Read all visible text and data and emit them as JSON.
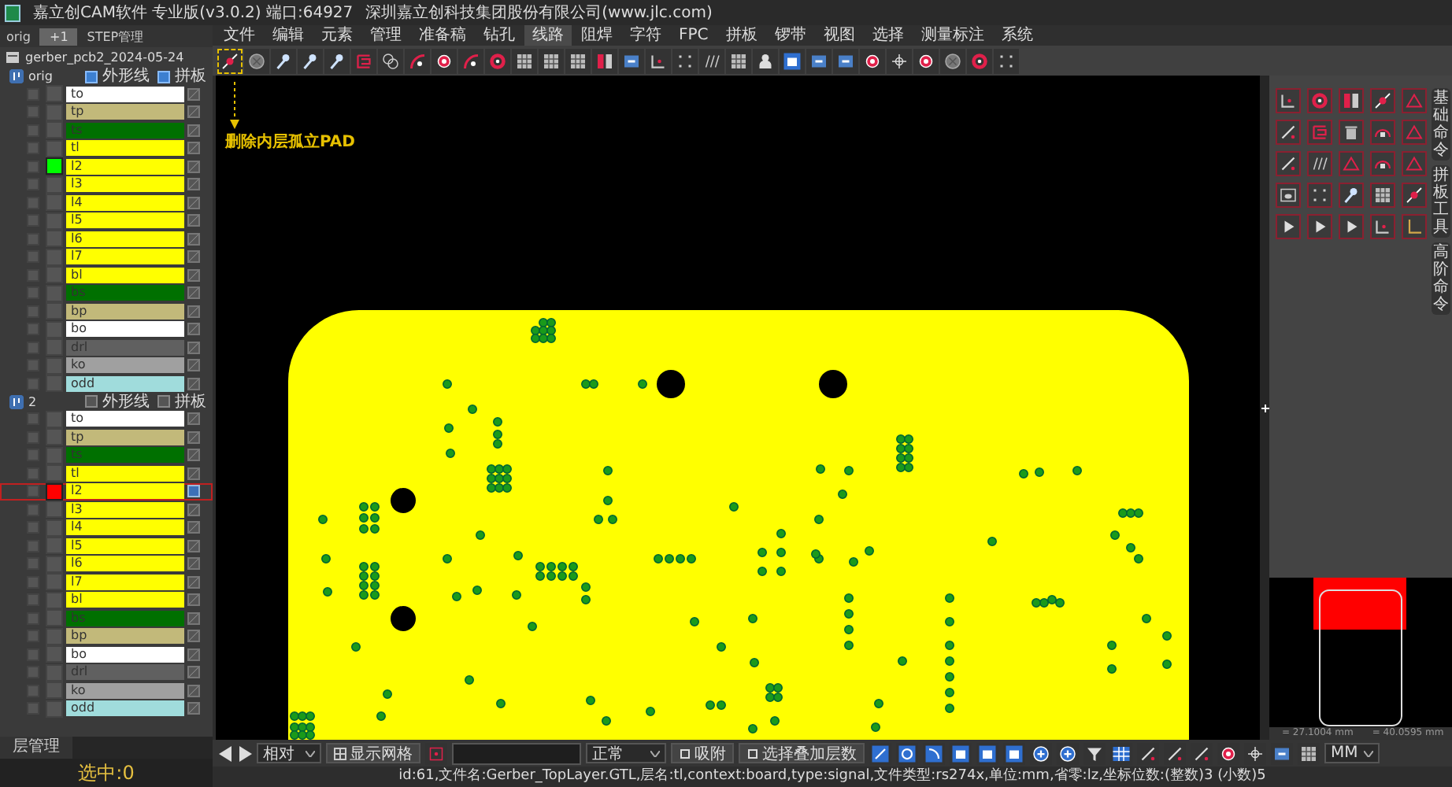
{
  "window": {
    "title": "嘉立创CAM软件 专业版(v3.0.2) 端口:64927",
    "company": "深圳嘉立创科技集团股份有限公司(www.jlc.com)"
  },
  "menu": [
    {
      "label": "文件",
      "selected": false
    },
    {
      "label": "编辑",
      "selected": false
    },
    {
      "label": "元素",
      "selected": false
    },
    {
      "label": "管理",
      "selected": false
    },
    {
      "label": "准备稿",
      "selected": false
    },
    {
      "label": "钻孔",
      "selected": false
    },
    {
      "label": "线路",
      "selected": true
    },
    {
      "label": "阻焊",
      "selected": false
    },
    {
      "label": "字符",
      "selected": false
    },
    {
      "label": "FPC",
      "selected": false
    },
    {
      "label": "拼板",
      "selected": false
    },
    {
      "label": "锣带",
      "selected": false
    },
    {
      "label": "视图",
      "selected": false
    },
    {
      "label": "选择",
      "selected": false
    },
    {
      "label": "测量标注",
      "selected": false
    },
    {
      "label": "系统",
      "selected": false
    }
  ],
  "toolbar": {
    "tools": [
      {
        "selected": true
      },
      {
        "selected": false
      },
      {
        "selected": false
      },
      {
        "selected": false
      },
      {
        "selected": false
      },
      {
        "selected": false
      },
      {
        "selected": false
      },
      {
        "selected": false
      },
      {
        "selected": false
      },
      {
        "selected": false
      },
      {
        "selected": false
      },
      {
        "selected": false
      },
      {
        "selected": false
      },
      {
        "selected": false
      },
      {
        "selected": false
      },
      {
        "selected": false
      },
      {
        "selected": false
      },
      {
        "selected": false
      },
      {
        "selected": false
      },
      {
        "selected": false
      },
      {
        "selected": false
      },
      {
        "selected": false
      },
      {
        "selected": false
      },
      {
        "selected": false
      },
      {
        "selected": false
      },
      {
        "selected": false
      },
      {
        "selected": false
      },
      {
        "selected": false
      },
      {
        "selected": false
      },
      {
        "selected": false
      }
    ]
  },
  "tooltip": {
    "text": "删除内层孤立PAD"
  },
  "left_panel": {
    "step_tab": "orig",
    "add_button": "+1",
    "step_manager": "STEP管理",
    "job": "gerber_pcb2_2024-05-24",
    "steps": [
      {
        "name": "orig",
        "outline_label": "外形线",
        "outline_checked": true,
        "panel_label": "拼板",
        "panel_checked": true,
        "layers": [
          {
            "name": "to",
            "color": "#ffffff",
            "checked": false,
            "selected": false,
            "active": false
          },
          {
            "name": "tp",
            "color": "#c2b97a",
            "checked": false,
            "selected": false,
            "active": false
          },
          {
            "name": "ts",
            "color": "#007000",
            "checked": false,
            "selected": false,
            "active": false
          },
          {
            "name": "tl",
            "color": "#ffff00",
            "checked": false,
            "selected": false,
            "active": false
          },
          {
            "name": "l2",
            "color": "#ffff00",
            "checked": false,
            "selected": false,
            "active": true,
            "marker": {
              "color": "#00ff00"
            }
          },
          {
            "name": "l3",
            "color": "#ffff00",
            "checked": false,
            "selected": false,
            "active": false
          },
          {
            "name": "l4",
            "color": "#ffff00",
            "checked": false,
            "selected": false,
            "active": false
          },
          {
            "name": "l5",
            "color": "#ffff00",
            "checked": false,
            "selected": false,
            "active": false
          },
          {
            "name": "l6",
            "color": "#ffff00",
            "checked": false,
            "selected": false,
            "active": false
          },
          {
            "name": "l7",
            "color": "#ffff00",
            "checked": false,
            "selected": false,
            "active": false
          },
          {
            "name": "bl",
            "color": "#ffff00",
            "checked": false,
            "selected": false,
            "active": false
          },
          {
            "name": "bs",
            "color": "#007000",
            "checked": false,
            "selected": false,
            "active": false
          },
          {
            "name": "bp",
            "color": "#c2b97a",
            "checked": false,
            "selected": false,
            "active": false
          },
          {
            "name": "bo",
            "color": "#ffffff",
            "checked": false,
            "selected": false,
            "active": false
          },
          {
            "name": "drl",
            "color": "#606060",
            "checked": false,
            "selected": false,
            "active": false
          },
          {
            "name": "ko",
            "color": "#a0a0a0",
            "checked": false,
            "selected": false,
            "active": false
          },
          {
            "name": "odd",
            "color": "#a0dcdc",
            "checked": false,
            "selected": false,
            "active": false
          }
        ]
      },
      {
        "name": "2",
        "outline_label": "外形线",
        "outline_checked": false,
        "panel_label": "拼板",
        "panel_checked": false,
        "layers": [
          {
            "name": "to",
            "color": "#ffffff",
            "checked": false,
            "selected": false,
            "active": false
          },
          {
            "name": "tp",
            "color": "#c2b97a",
            "checked": false,
            "selected": false,
            "active": false
          },
          {
            "name": "ts",
            "color": "#007000",
            "checked": false,
            "selected": false,
            "active": false
          },
          {
            "name": "tl",
            "color": "#ffff00",
            "checked": false,
            "selected": false,
            "active": false
          },
          {
            "name": "l2",
            "color": "#ffff00",
            "checked": false,
            "selected": true,
            "active": true,
            "marker": {
              "color": "#ff0000"
            }
          },
          {
            "name": "l3",
            "color": "#ffff00",
            "checked": false,
            "selected": false,
            "active": false
          },
          {
            "name": "l4",
            "color": "#ffff00",
            "checked": false,
            "selected": false,
            "active": false
          },
          {
            "name": "l5",
            "color": "#ffff00",
            "checked": false,
            "selected": false,
            "active": false
          },
          {
            "name": "l6",
            "color": "#ffff00",
            "checked": false,
            "selected": false,
            "active": false
          },
          {
            "name": "l7",
            "color": "#ffff00",
            "checked": false,
            "selected": false,
            "active": false
          },
          {
            "name": "bl",
            "color": "#ffff00",
            "checked": false,
            "selected": false,
            "active": false
          },
          {
            "name": "bs",
            "color": "#007000",
            "checked": false,
            "selected": false,
            "active": false
          },
          {
            "name": "bp",
            "color": "#c2b97a",
            "checked": false,
            "selected": false,
            "active": false
          },
          {
            "name": "bo",
            "color": "#ffffff",
            "checked": false,
            "selected": false,
            "active": false
          },
          {
            "name": "drl",
            "color": "#606060",
            "checked": false,
            "selected": false,
            "active": false
          },
          {
            "name": "ko",
            "color": "#a0a0a0",
            "checked": false,
            "selected": false,
            "active": false
          },
          {
            "name": "odd",
            "color": "#a0dcdc",
            "checked": false,
            "selected": false,
            "active": false
          }
        ]
      }
    ],
    "footer_tab": "层管理",
    "selection": "选中:0"
  },
  "right_panel": {
    "tabs": [
      "基础命令",
      "拼板工具",
      "高阶命令"
    ],
    "coords": [
      "= 27.1004 mm",
      "= 40.0595 mm"
    ]
  },
  "bottom_toolbar": {
    "mode": "相对",
    "grid_button": "显示网格",
    "blend": "正常",
    "snap_button": "吸附",
    "layers_button": "选择叠加层数",
    "unit": "MM"
  },
  "status_bar": "id:61,文件名:Gerber_TopLayer.GTL,层名:tl,context:board,type:signal,文件类型:rs274x,单位:mm,省零:lz,坐标位数:(整数)3 (小数)5"
}
